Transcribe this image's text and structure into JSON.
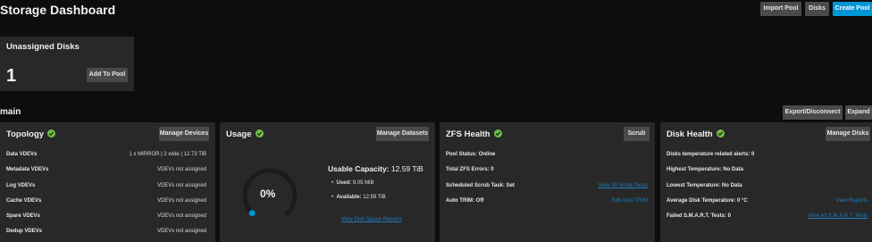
{
  "header": {
    "title": "Storage Dashboard",
    "import_pool": "Import Pool",
    "disks": "Disks",
    "create_pool": "Create Pool"
  },
  "unassigned": {
    "title": "Unassigned Disks",
    "count": "1",
    "add_to_pool": "Add To Pool"
  },
  "pool": {
    "name": "main",
    "export_disconnect": "Export/Disconnect",
    "expand": "Expand"
  },
  "topology": {
    "title": "Topology",
    "action": "Manage Devices",
    "rows": [
      {
        "label": "Data VDEVs",
        "value": "1 x MIRROR | 2 wide | 12.73 TiB"
      },
      {
        "label": "Metadata VDEVs",
        "value": "VDEVs not assigned"
      },
      {
        "label": "Log VDEVs",
        "value": "VDEVs not assigned"
      },
      {
        "label": "Cache VDEVs",
        "value": "VDEVs not assigned"
      },
      {
        "label": "Spare VDEVs",
        "value": "VDEVs not assigned"
      },
      {
        "label": "Dedup VDEVs",
        "value": "VDEVs not assigned"
      }
    ]
  },
  "usage": {
    "title": "Usage",
    "action": "Manage Datasets",
    "percent": "0%",
    "percent_value": 0,
    "usable_label": "Usable Capacity:",
    "usable_value": "12.59 TiB",
    "used_label": "Used:",
    "used_value": "9.05 MiB",
    "available_label": "Available:",
    "available_value": "12.59 TiB",
    "report_link": "View Disk Space Reports"
  },
  "zfs": {
    "title": "ZFS Health",
    "action": "Scrub",
    "pool_status": "Pool Status: Online",
    "total_errors": "Total ZFS Errors: 0",
    "scrub_task": "Scheduled Scrub Task: Set",
    "scrub_link": "View All Scrub Tasks",
    "auto_trim": "Auto TRIM: Off",
    "trim_link": "Edit Auto TRIM"
  },
  "disk_health": {
    "title": "Disk Health",
    "action": "Manage Disks",
    "temp_alerts": "Disks temperature related alerts: 0",
    "highest_temp": "Highest Temperature: No Data",
    "lowest_temp": "Lowest Temperature: No Data",
    "avg_temp": "Average Disk Temperature: 0 °C",
    "reports_link": "View Reports",
    "failed_smart": "Failed S.M.A.R.T. Tests: 0",
    "smart_link": "View All S.M.A.R.T. Tests"
  },
  "colors": {
    "accent": "#0095d5",
    "ok": "#71bf44",
    "card": "#282828",
    "background": "#0d0d0d"
  }
}
